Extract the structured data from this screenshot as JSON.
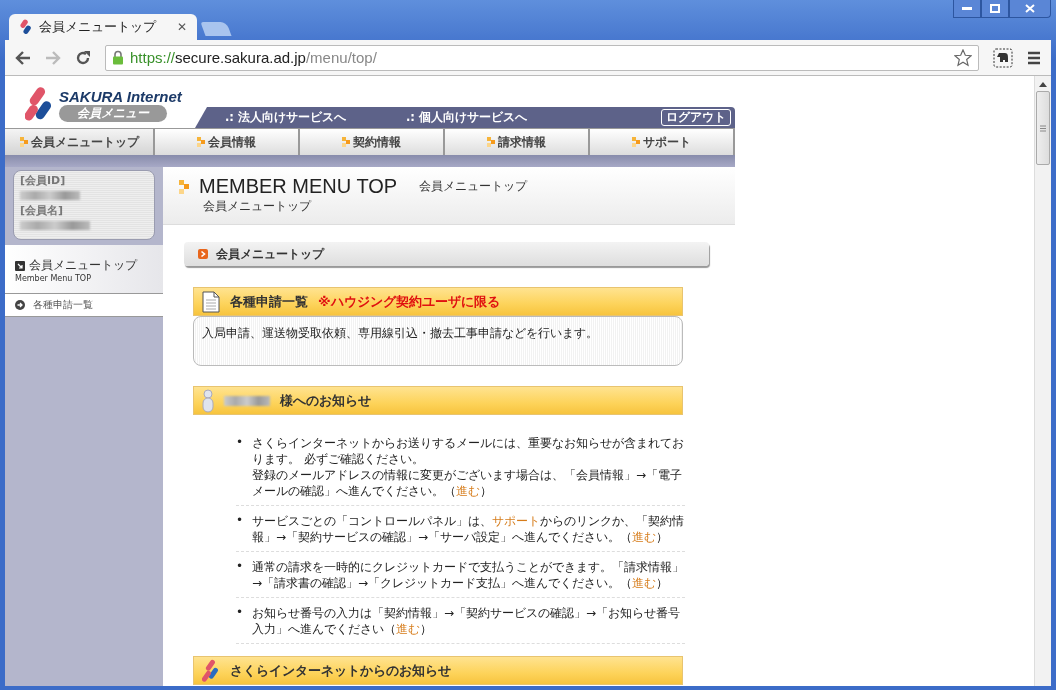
{
  "browser": {
    "tabs": [
      {
        "title": "会員メニュートップ",
        "selected": true
      },
      {
        "selected": false
      }
    ],
    "close_glyph": "✕",
    "url": {
      "scheme": "https://",
      "host": "secure.sakura.ad.jp",
      "path": "/menu/top/"
    }
  },
  "header": {
    "logo_title": "SAKURA Internet",
    "logo_subtitle": "会員メニュー",
    "links": [
      ".: 法人向けサービスへ",
      ".: 個人向けサービスへ"
    ],
    "logout": "ログアウト"
  },
  "nav": [
    {
      "label": "会員メニュートップ",
      "selected": true
    },
    {
      "label": "会員情報",
      "selected": false
    },
    {
      "label": "契約情報",
      "selected": false
    },
    {
      "label": "請求情報",
      "selected": false
    },
    {
      "label": "サポート",
      "selected": false
    }
  ],
  "member_card": {
    "id_label": "[会員ID]",
    "name_label": "[会員名]"
  },
  "sidebar": {
    "title": "会員メニュートップ",
    "subtitle": "Member Menu TOP",
    "items": [
      "各種申請一覧"
    ]
  },
  "page_title": {
    "en": "MEMBER MENU TOP",
    "ja": "会員メニュートップ",
    "sub": "会員メニュートップ"
  },
  "breadcrumb": "会員メニュートップ",
  "applications": {
    "title": "各種申請一覧",
    "note": "※ハウジング契約ユーザに限る",
    "body": "入局申請、運送物受取依頼、専用線引込・撤去工事申請などを行います。"
  },
  "notices": {
    "title": "様へのお知らせ",
    "items": [
      {
        "bullet": "•",
        "segments": [
          {
            "kind": "text",
            "text": "さくらインターネットからお送りするメールには、重要なお知らせが含まれております。 必ずご確認ください。"
          },
          {
            "kind": "break"
          },
          {
            "kind": "text",
            "text": "登録のメールアドレスの情報に変更がございます場合は、「会員情報」→「電子メールの確認」へ進んでください。（"
          },
          {
            "kind": "link",
            "text": "進む"
          },
          {
            "kind": "text",
            "text": "）"
          }
        ]
      },
      {
        "bullet": "•",
        "segments": [
          {
            "kind": "text",
            "text": "サービスごとの「コントロールパネル」は、"
          },
          {
            "kind": "link",
            "text": "サポート"
          },
          {
            "kind": "text",
            "text": "からのリンクか、「契約情報」→「契約サービスの確認」→「サーバ設定」へ進んでください。（"
          },
          {
            "kind": "link",
            "text": "進む"
          },
          {
            "kind": "text",
            "text": "）"
          }
        ]
      },
      {
        "bullet": "•",
        "segments": [
          {
            "kind": "text",
            "text": "通常の請求を一時的にクレジットカードで支払うことができます。「請求情報」→「請求書の確認」→「クレジットカード支払」へ進んでください。（"
          },
          {
            "kind": "link",
            "text": "進む"
          },
          {
            "kind": "text",
            "text": "）"
          }
        ]
      },
      {
        "bullet": "•",
        "segments": [
          {
            "kind": "text",
            "text": "お知らせ番号の入力は「契約情報」→「契約サービスの確認」→「お知らせ番号入力」へ進んでください（"
          },
          {
            "kind": "link",
            "text": "進む"
          },
          {
            "kind": "text",
            "text": "）"
          }
        ]
      }
    ]
  },
  "sakura_news": {
    "title": "さくらインターネットからのお知らせ"
  }
}
